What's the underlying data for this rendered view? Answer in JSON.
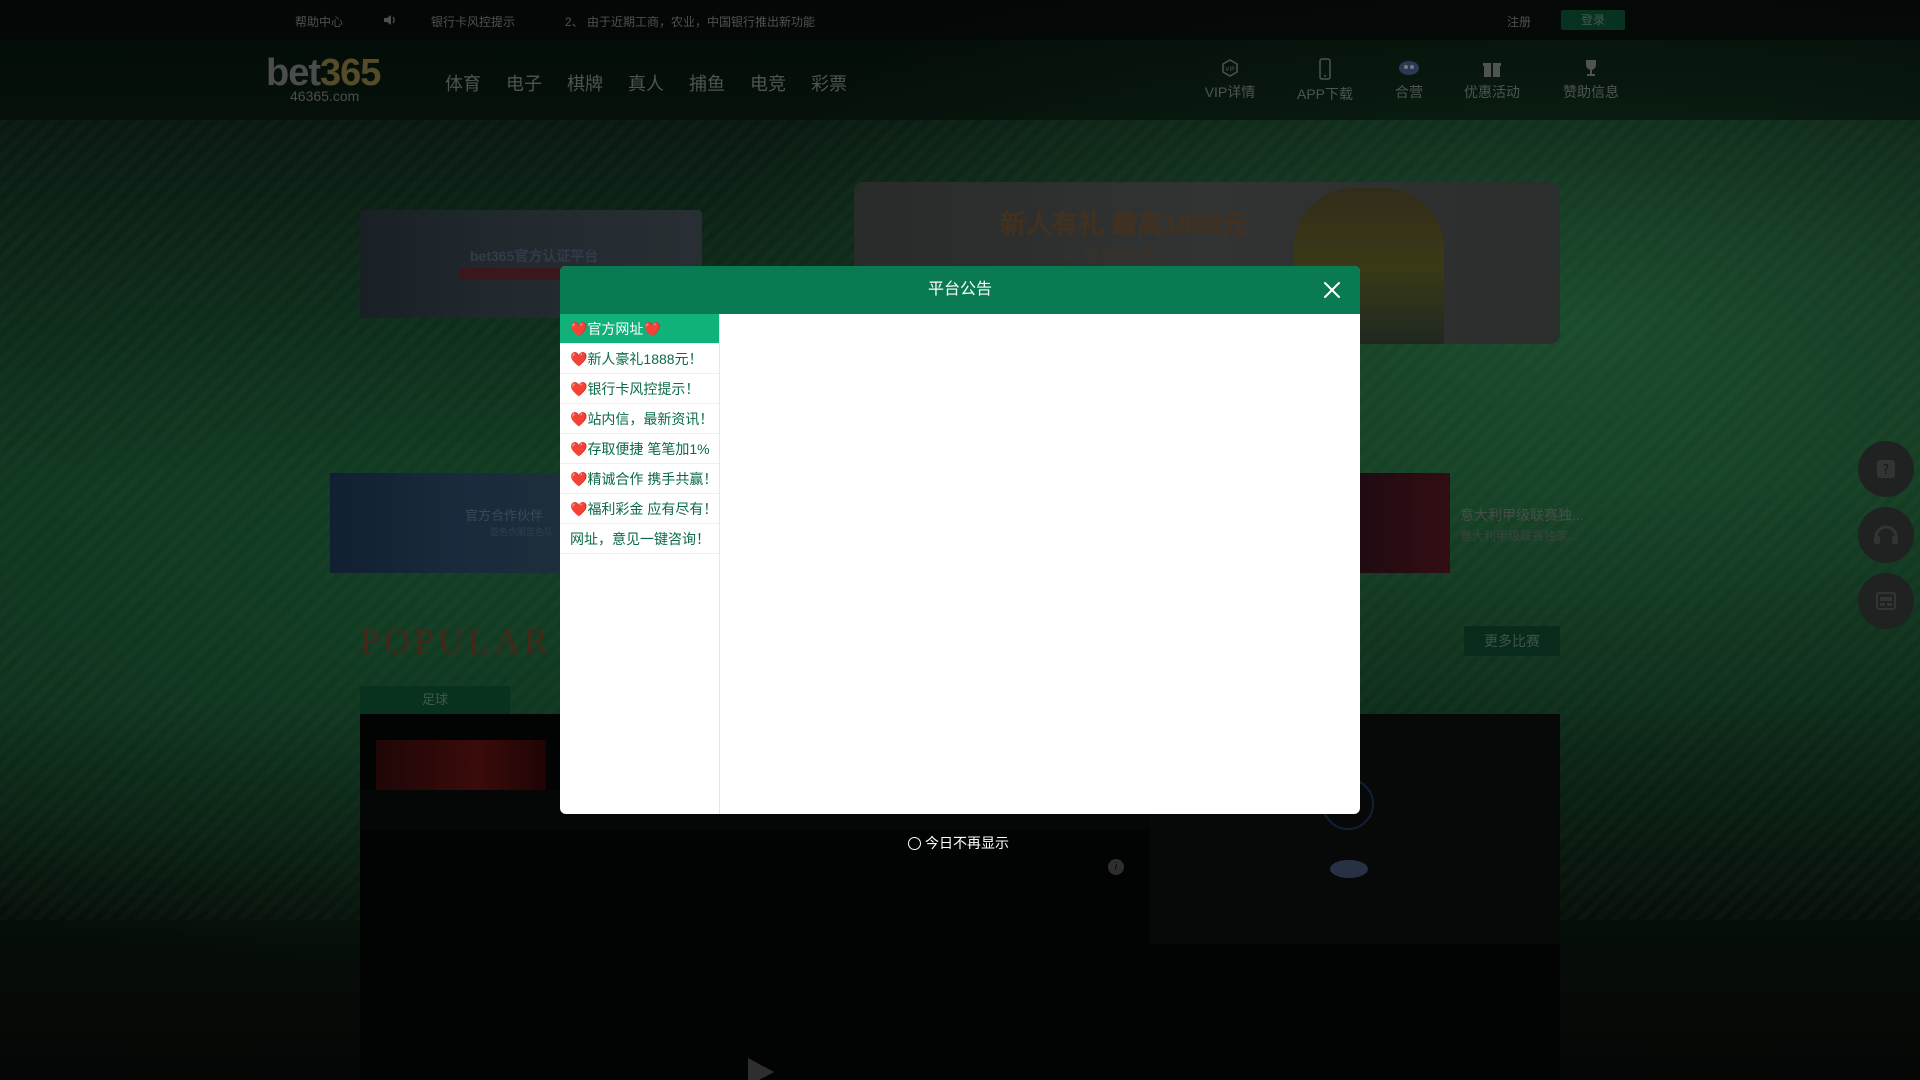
{
  "topbar": {
    "help": "帮助中心",
    "notice_label": "银行卡风控提示",
    "marquee": "2、 由于近期工商，农业，中国银行推出新功能",
    "register": "注册",
    "login": "登录"
  },
  "header": {
    "logo_main": "bet",
    "logo_num": "365",
    "logo_sub": "46365.com",
    "nav": [
      "体育",
      "电子",
      "棋牌",
      "真人",
      "捕鱼",
      "电竞",
      "彩票"
    ],
    "icon_nav": [
      {
        "label": "VIP详情",
        "icon": "vip-icon"
      },
      {
        "label": "APP下载",
        "icon": "phone-icon"
      },
      {
        "label": "合营",
        "icon": "partner-icon"
      },
      {
        "label": "优惠活动",
        "icon": "gift-icon"
      },
      {
        "label": "赞助信息",
        "icon": "trophy-icon"
      }
    ]
  },
  "banners": {
    "left_title": "bet365官方认证平台",
    "right_title": "新人有礼 最高1888元",
    "right_sub": "— 笔笔首送 —",
    "strip_left_title": "官方合作伙伴",
    "strip_left_sub": "蓝色衣服蓝色队",
    "news_title": "意大利甲级联赛独...",
    "news_sub": "意大利甲级联赛独家..."
  },
  "popular": {
    "title": "POPULAR",
    "more": "更多比赛",
    "tab": "足球"
  },
  "modal": {
    "title": "平台公告",
    "items": [
      {
        "heart": "❤️",
        "text": "官方网址",
        "heart_end": "❤️"
      },
      {
        "heart": "❤️",
        "text": "新人豪礼1888元！",
        "heart_end": ""
      },
      {
        "heart": "❤️",
        "text": "银行卡风控提示！",
        "heart_end": ""
      },
      {
        "heart": "❤️",
        "text": "站内信，最新资讯！",
        "heart_end": ""
      },
      {
        "heart": "❤️",
        "text": "存取便捷 笔笔加1%",
        "heart_end": ""
      },
      {
        "heart": "❤️",
        "text": "精诚合作 携手共赢！",
        "heart_end": ""
      },
      {
        "heart": "❤️",
        "text": "福利彩金 应有尽有！",
        "heart_end": ""
      },
      {
        "heart": "",
        "text": "网址，意见一键咨询！",
        "heart_end": ""
      }
    ],
    "dont_show": "今日不再显示"
  },
  "colors": {
    "modal_header": "#097a52",
    "active_item": "#11b27a",
    "item_text": "#0b6b45"
  }
}
